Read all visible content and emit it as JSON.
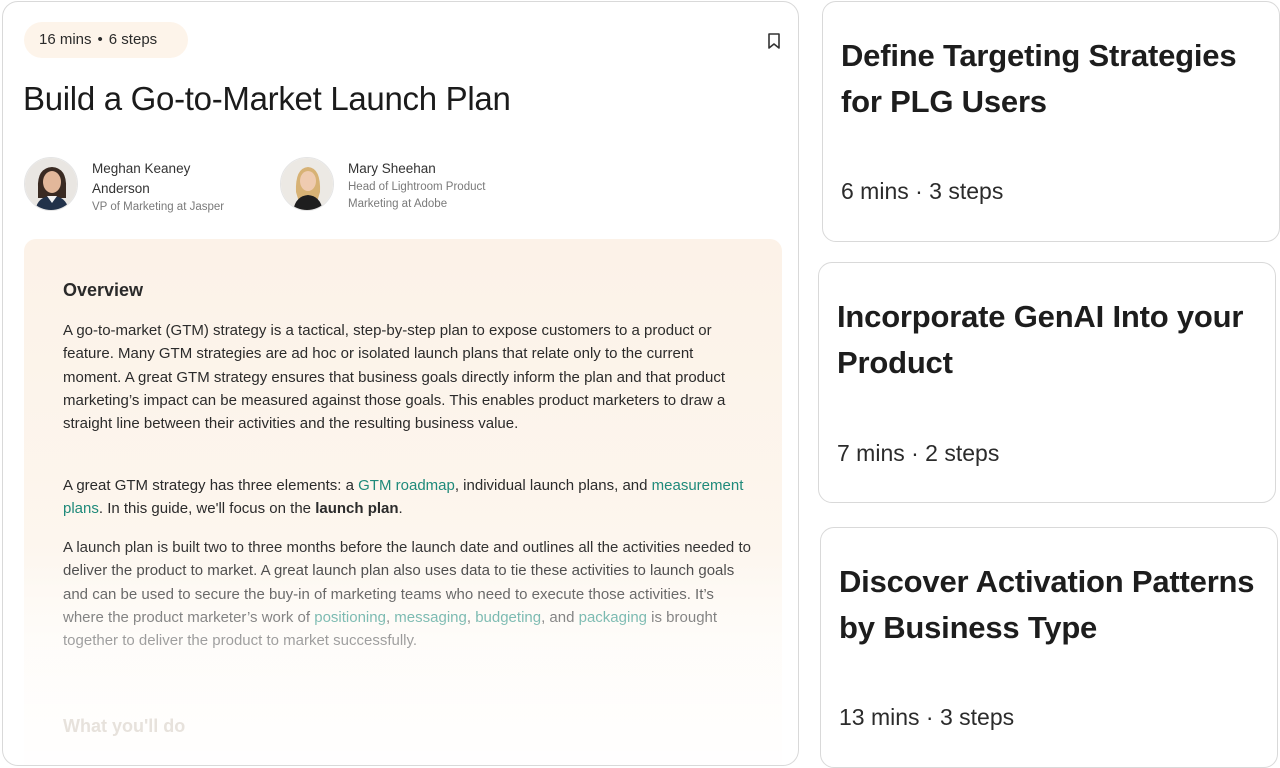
{
  "guide": {
    "duration": "16 mins",
    "steps": "6 steps",
    "separator": "•",
    "title": "Build a Go-to-Market Launch Plan",
    "authors": [
      {
        "name": "Meghan Keaney Anderson",
        "role": "VP of Marketing at Jasper"
      },
      {
        "name": "Mary Sheehan",
        "role": "Head of Lightroom Product Marketing at Adobe"
      }
    ],
    "overview": {
      "heading": "Overview",
      "p1": "A go-to-market (GTM) strategy is a tactical, step-by-step plan to expose customers to a product or feature. Many GTM strategies are ad hoc or isolated launch plans that relate only to the current moment. A great GTM strategy ensures that business goals directly inform the plan and that product marketing’s impact can be measured against those goals. This enables product marketers to draw a straight line between their activities and the resulting business value.",
      "p2": {
        "t1": "A great GTM strategy has three elements: a ",
        "link1": "GTM roadmap",
        "t2": ", individual launch plans, and ",
        "link2": "measurement plans",
        "t3": ". In this guide, we'll focus on the ",
        "bold": "launch plan",
        "t4": "."
      },
      "p3": {
        "t1": "A launch plan is built two to three months before the launch date and outlines all the activities needed to deliver the product to market. A great launch plan also uses data to tie these activities to launch goals and can be used to secure the buy-in of marketing teams who need to execute those activities. It’s where the product marketer’s work of ",
        "link1": "positioning",
        "t2": ", ",
        "link2": "messaging",
        "t3": ", ",
        "link3": "budgeting",
        "t4": ", and ",
        "link4": "packaging",
        "t5": " is brought together to deliver the product to market successfully."
      },
      "next_heading": "What you'll do"
    }
  },
  "related": [
    {
      "title": "Define Targeting Strategies for PLG Users",
      "meta": "6 mins · 3 steps"
    },
    {
      "title": "Incorporate GenAI Into your Product",
      "meta": "7 mins · 2 steps"
    },
    {
      "title": "Discover Activation Patterns by Business Type",
      "meta": "13 mins · 3 steps"
    }
  ],
  "colors": {
    "link": "#1f8a7a",
    "pill_bg": "#fdf4ea",
    "overview_bg": "#fcf2e8"
  },
  "icons": {
    "bookmark": "bookmark-icon"
  }
}
